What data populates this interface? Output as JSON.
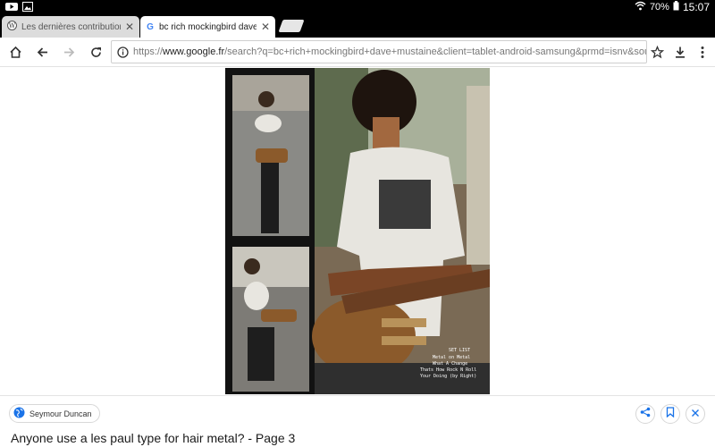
{
  "status_bar": {
    "battery": "70%",
    "time": "15:07",
    "left_icons": [
      "youtube-icon",
      "gallery-icon"
    ],
    "right_icons": [
      "wifi-icon",
      "battery-icon"
    ]
  },
  "tabs": [
    {
      "title": "Les dernières contributions d",
      "favicon": "wiki-favicon",
      "active": false
    },
    {
      "title": "bc rich mockingbird dave mu",
      "favicon": "google-favicon",
      "active": true
    }
  ],
  "toolbar": {
    "url_prefix": "https://",
    "url_domain": "www.google.fr",
    "url_path": "/search?q=bc+rich+mockingbird+dave+mustaine&client=tablet-android-samsung&prmd=isnv&source=lnms",
    "icons": [
      "home-icon",
      "back-icon",
      "forward-icon",
      "reload-icon",
      "info-icon",
      "bookmark-star-icon",
      "download-icon",
      "menu-icon"
    ]
  },
  "result": {
    "source": "Seymour Duncan",
    "title": "Anyone use a les paul type for hair metal? - Page 3",
    "image_overlay_text": [
      "SET LIST",
      "Metal on Metal",
      "What A Change",
      "Thats How Rock N Roll",
      "Your Doing (by Right)"
    ],
    "actions": [
      "share-icon",
      "bookmark-icon",
      "close-icon"
    ]
  },
  "colors": {
    "status_bar_bg": "#000000",
    "tab_active_bg": "#ffffff",
    "tab_inactive_bg": "#dcdcdc",
    "google_blue": "#4285f4"
  }
}
